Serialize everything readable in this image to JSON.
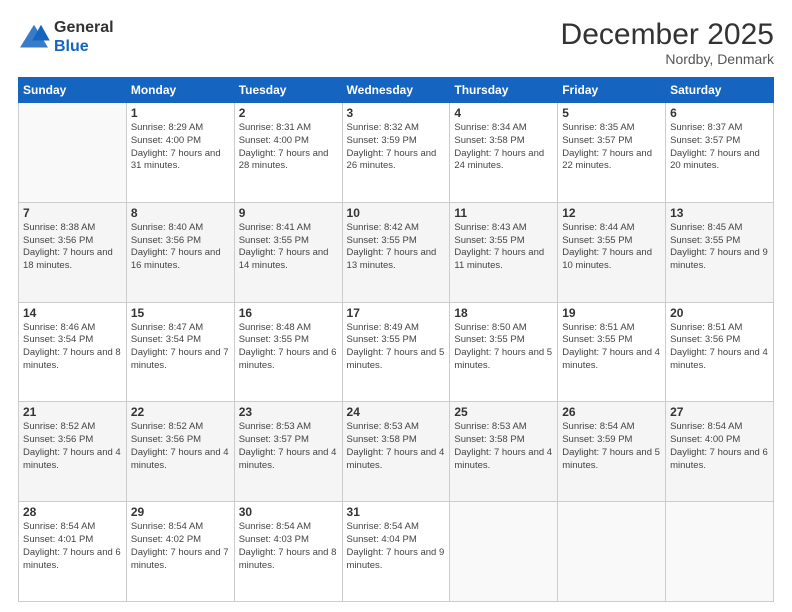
{
  "logo": {
    "line1": "General",
    "line2": "Blue"
  },
  "title": "December 2025",
  "subtitle": "Nordby, Denmark",
  "weekdays": [
    "Sunday",
    "Monday",
    "Tuesday",
    "Wednesday",
    "Thursday",
    "Friday",
    "Saturday"
  ],
  "weeks": [
    [
      {
        "day": "",
        "sunrise": "",
        "sunset": "",
        "daylight": ""
      },
      {
        "day": "1",
        "sunrise": "Sunrise: 8:29 AM",
        "sunset": "Sunset: 4:00 PM",
        "daylight": "Daylight: 7 hours and 31 minutes."
      },
      {
        "day": "2",
        "sunrise": "Sunrise: 8:31 AM",
        "sunset": "Sunset: 4:00 PM",
        "daylight": "Daylight: 7 hours and 28 minutes."
      },
      {
        "day": "3",
        "sunrise": "Sunrise: 8:32 AM",
        "sunset": "Sunset: 3:59 PM",
        "daylight": "Daylight: 7 hours and 26 minutes."
      },
      {
        "day": "4",
        "sunrise": "Sunrise: 8:34 AM",
        "sunset": "Sunset: 3:58 PM",
        "daylight": "Daylight: 7 hours and 24 minutes."
      },
      {
        "day": "5",
        "sunrise": "Sunrise: 8:35 AM",
        "sunset": "Sunset: 3:57 PM",
        "daylight": "Daylight: 7 hours and 22 minutes."
      },
      {
        "day": "6",
        "sunrise": "Sunrise: 8:37 AM",
        "sunset": "Sunset: 3:57 PM",
        "daylight": "Daylight: 7 hours and 20 minutes."
      }
    ],
    [
      {
        "day": "7",
        "sunrise": "Sunrise: 8:38 AM",
        "sunset": "Sunset: 3:56 PM",
        "daylight": "Daylight: 7 hours and 18 minutes."
      },
      {
        "day": "8",
        "sunrise": "Sunrise: 8:40 AM",
        "sunset": "Sunset: 3:56 PM",
        "daylight": "Daylight: 7 hours and 16 minutes."
      },
      {
        "day": "9",
        "sunrise": "Sunrise: 8:41 AM",
        "sunset": "Sunset: 3:55 PM",
        "daylight": "Daylight: 7 hours and 14 minutes."
      },
      {
        "day": "10",
        "sunrise": "Sunrise: 8:42 AM",
        "sunset": "Sunset: 3:55 PM",
        "daylight": "Daylight: 7 hours and 13 minutes."
      },
      {
        "day": "11",
        "sunrise": "Sunrise: 8:43 AM",
        "sunset": "Sunset: 3:55 PM",
        "daylight": "Daylight: 7 hours and 11 minutes."
      },
      {
        "day": "12",
        "sunrise": "Sunrise: 8:44 AM",
        "sunset": "Sunset: 3:55 PM",
        "daylight": "Daylight: 7 hours and 10 minutes."
      },
      {
        "day": "13",
        "sunrise": "Sunrise: 8:45 AM",
        "sunset": "Sunset: 3:55 PM",
        "daylight": "Daylight: 7 hours and 9 minutes."
      }
    ],
    [
      {
        "day": "14",
        "sunrise": "Sunrise: 8:46 AM",
        "sunset": "Sunset: 3:54 PM",
        "daylight": "Daylight: 7 hours and 8 minutes."
      },
      {
        "day": "15",
        "sunrise": "Sunrise: 8:47 AM",
        "sunset": "Sunset: 3:54 PM",
        "daylight": "Daylight: 7 hours and 7 minutes."
      },
      {
        "day": "16",
        "sunrise": "Sunrise: 8:48 AM",
        "sunset": "Sunset: 3:55 PM",
        "daylight": "Daylight: 7 hours and 6 minutes."
      },
      {
        "day": "17",
        "sunrise": "Sunrise: 8:49 AM",
        "sunset": "Sunset: 3:55 PM",
        "daylight": "Daylight: 7 hours and 5 minutes."
      },
      {
        "day": "18",
        "sunrise": "Sunrise: 8:50 AM",
        "sunset": "Sunset: 3:55 PM",
        "daylight": "Daylight: 7 hours and 5 minutes."
      },
      {
        "day": "19",
        "sunrise": "Sunrise: 8:51 AM",
        "sunset": "Sunset: 3:55 PM",
        "daylight": "Daylight: 7 hours and 4 minutes."
      },
      {
        "day": "20",
        "sunrise": "Sunrise: 8:51 AM",
        "sunset": "Sunset: 3:56 PM",
        "daylight": "Daylight: 7 hours and 4 minutes."
      }
    ],
    [
      {
        "day": "21",
        "sunrise": "Sunrise: 8:52 AM",
        "sunset": "Sunset: 3:56 PM",
        "daylight": "Daylight: 7 hours and 4 minutes."
      },
      {
        "day": "22",
        "sunrise": "Sunrise: 8:52 AM",
        "sunset": "Sunset: 3:56 PM",
        "daylight": "Daylight: 7 hours and 4 minutes."
      },
      {
        "day": "23",
        "sunrise": "Sunrise: 8:53 AM",
        "sunset": "Sunset: 3:57 PM",
        "daylight": "Daylight: 7 hours and 4 minutes."
      },
      {
        "day": "24",
        "sunrise": "Sunrise: 8:53 AM",
        "sunset": "Sunset: 3:58 PM",
        "daylight": "Daylight: 7 hours and 4 minutes."
      },
      {
        "day": "25",
        "sunrise": "Sunrise: 8:53 AM",
        "sunset": "Sunset: 3:58 PM",
        "daylight": "Daylight: 7 hours and 4 minutes."
      },
      {
        "day": "26",
        "sunrise": "Sunrise: 8:54 AM",
        "sunset": "Sunset: 3:59 PM",
        "daylight": "Daylight: 7 hours and 5 minutes."
      },
      {
        "day": "27",
        "sunrise": "Sunrise: 8:54 AM",
        "sunset": "Sunset: 4:00 PM",
        "daylight": "Daylight: 7 hours and 6 minutes."
      }
    ],
    [
      {
        "day": "28",
        "sunrise": "Sunrise: 8:54 AM",
        "sunset": "Sunset: 4:01 PM",
        "daylight": "Daylight: 7 hours and 6 minutes."
      },
      {
        "day": "29",
        "sunrise": "Sunrise: 8:54 AM",
        "sunset": "Sunset: 4:02 PM",
        "daylight": "Daylight: 7 hours and 7 minutes."
      },
      {
        "day": "30",
        "sunrise": "Sunrise: 8:54 AM",
        "sunset": "Sunset: 4:03 PM",
        "daylight": "Daylight: 7 hours and 8 minutes."
      },
      {
        "day": "31",
        "sunrise": "Sunrise: 8:54 AM",
        "sunset": "Sunset: 4:04 PM",
        "daylight": "Daylight: 7 hours and 9 minutes."
      },
      {
        "day": "",
        "sunrise": "",
        "sunset": "",
        "daylight": ""
      },
      {
        "day": "",
        "sunrise": "",
        "sunset": "",
        "daylight": ""
      },
      {
        "day": "",
        "sunrise": "",
        "sunset": "",
        "daylight": ""
      }
    ]
  ]
}
